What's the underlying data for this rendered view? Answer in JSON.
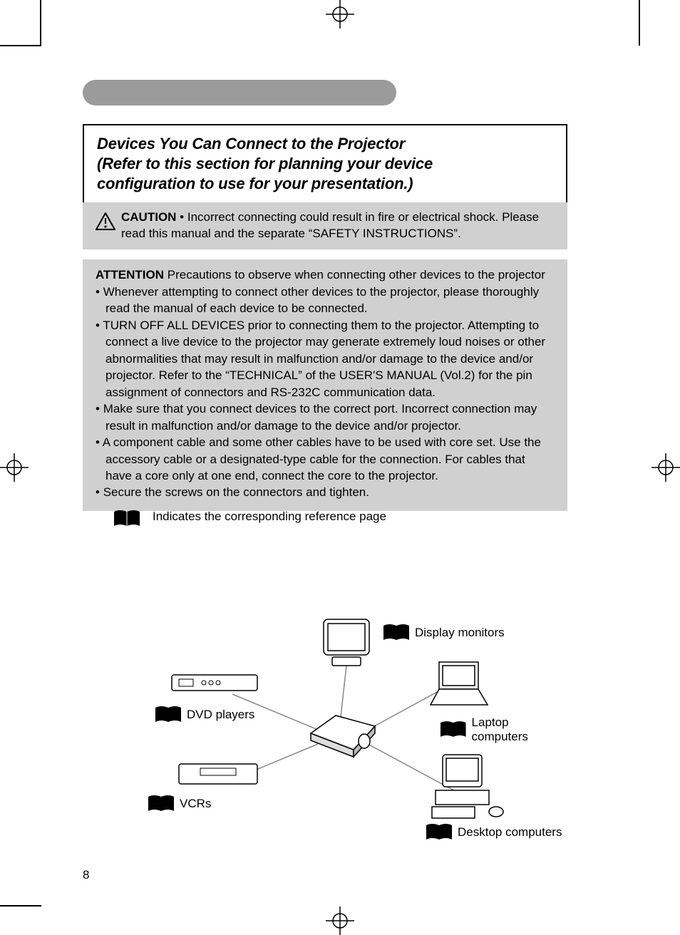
{
  "title": {
    "line1": "Devices You Can Connect to the Projector",
    "line2": "(Refer to this section for planning your device",
    "line3": "configuration to use for your presentation.)"
  },
  "caution": {
    "label": "CAUTION",
    "text": " • Incorrect connecting could result in fire or electrical shock. Please read this manual and the separate “SAFETY INSTRUCTIONS”."
  },
  "attention": {
    "label": "ATTENTION",
    "subtitle": "  Precautions to observe when connecting other devices to the projector",
    "items": [
      "Whenever attempting to connect other devices to the projector, please thoroughly read the manual of each device to be connected.",
      "TURN OFF ALL DEVICES prior to connecting them to the projector. Attempting to connect a live device to the projector may generate extremely loud noises or other abnormalities that may result in malfunction and/or damage to the device and/or projector. Refer to the “TECHNICAL” of the USER'S MANUAL (Vol.2) for the pin assignment of connectors and RS-232C communication data.",
      "Make sure that you connect devices to the correct port. Incorrect connection may result in malfunction and/or damage to the device and/or projector.",
      "A component cable and some other cables have to be used with core set. Use the accessory cable or a designated-type cable for the connection. For cables that have a core only at one end, connect the core to the projector.",
      "Secure the screws on the connectors and tighten."
    ]
  },
  "legend_text": "Indicates the corresponding reference page",
  "diagram": {
    "display_monitors": "Display monitors",
    "laptop_computers": "Laptop computers",
    "desktop_computers": "Desktop computers",
    "vcrs": "VCRs",
    "dvd_players": "DVD players"
  },
  "page_number": "8"
}
